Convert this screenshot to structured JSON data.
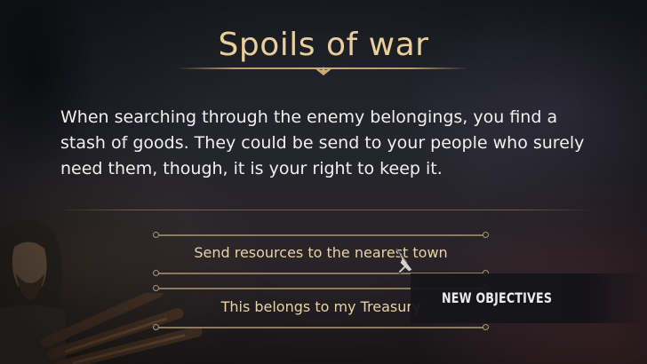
{
  "dialog": {
    "title": "Spoils of war",
    "body": "When searching through the enemy belongings, you find a stash of goods. They could be send to your people who surely need them, though, it is your right to keep it.",
    "options": [
      {
        "label": "Send resources to the nearest town"
      },
      {
        "label": "This belongs to my Treasury"
      }
    ]
  },
  "hud": {
    "objectives_label": "NEW OBJECTIVES"
  },
  "colors": {
    "title": "#e9cf9a",
    "body": "#f2f0ec",
    "option": "#e9d3a4",
    "rail": "#8a7a62"
  },
  "icons": {
    "title_ornament": "winged-ornament-icon",
    "cursor": "sword-cursor-icon"
  }
}
